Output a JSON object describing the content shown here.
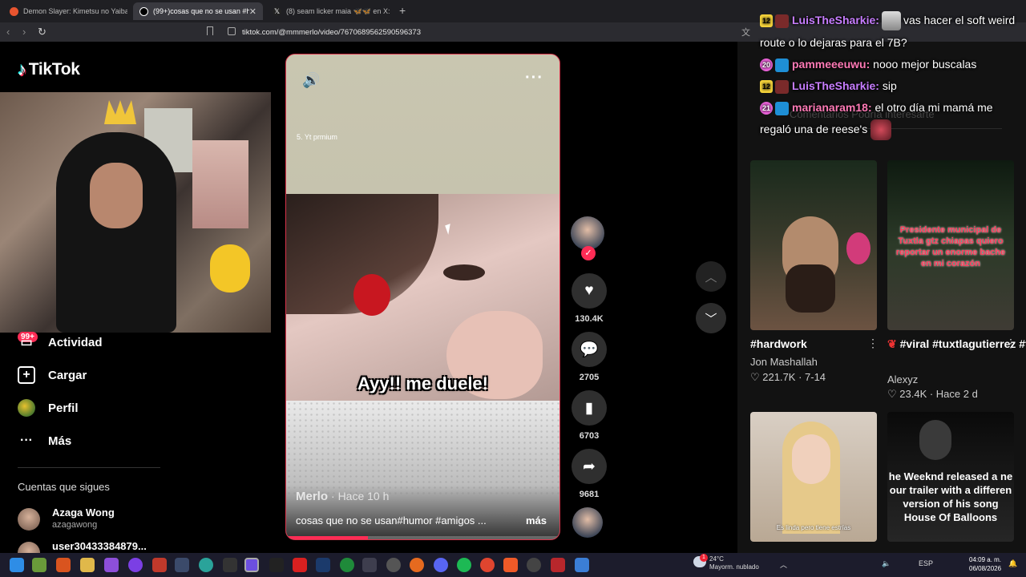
{
  "browser": {
    "tabs": [
      {
        "title": "Demon Slayer: Kimetsu no Yaiba en B",
        "color": "#e8542f"
      },
      {
        "title": "(99+)cosas que no se usan #hum",
        "color": "#ffffff"
      },
      {
        "title": "(8) seam licker maia 🦋🦋 en X: \"Du",
        "color": "#ffffff"
      }
    ],
    "url": "tiktok.com/@mmmerlo/video/7670689562590596373"
  },
  "sidebar": {
    "logo_text": "TikTok",
    "notif_badge": "99+",
    "nav": [
      {
        "label": "Actividad",
        "icon": "inbox-icon"
      },
      {
        "label": "Cargar",
        "icon": "upload-icon"
      },
      {
        "label": "Perfil",
        "icon": "profile-icon"
      },
      {
        "label": "Más",
        "icon": "more-icon"
      }
    ],
    "following_title": "Cuentas que sigues",
    "following": [
      {
        "name": "Azaga Wong",
        "handle": "azagawong"
      },
      {
        "name": "user30433384879...",
        "handle": ""
      }
    ]
  },
  "video": {
    "overlay_small_text": "5. Yt prmium",
    "caption": "Ayy!! me duele!",
    "author": "Merlo",
    "time": "· Hace 10 h",
    "description": "cosas que no se usan#humor #amigos ...",
    "more_label": "más",
    "progress": 0.3
  },
  "actions": {
    "likes": "130.4K",
    "comments": "2705",
    "saves": "6703",
    "shares": "9681"
  },
  "right_panel": {
    "tabs_text": "Comentarios     Podría interesarte",
    "chat": [
      {
        "level": "12",
        "level_style": "y",
        "user": "LuisTheSharkie",
        "text": "vas hacer el soft weird",
        "user_style": "u1"
      },
      {
        "level": "",
        "level_style": "",
        "user": "",
        "text": "route o lo dejaras para el 7B?",
        "user_style": ""
      },
      {
        "level": "20",
        "level_style": "p",
        "user": "pammeeeuwu",
        "text": "nooo mejor buscalas",
        "user_style": "u2"
      },
      {
        "level": "12",
        "level_style": "y",
        "user": "LuisTheSharkie",
        "text": "sip",
        "user_style": "u1"
      },
      {
        "level": "21",
        "level_style": "p",
        "user": "marianaram18",
        "text": "el otro día mi mamá me",
        "user_style": "u2"
      },
      {
        "level": "",
        "level_style": "",
        "user": "",
        "text": "regaló una de reese's",
        "user_style": ""
      }
    ],
    "cards": [
      {
        "title": "#hardwork",
        "user": "Jon Mashallah",
        "meta": "♡ 221.7K · 7-14",
        "thumb_text": ""
      },
      {
        "title": "#viral #tuxtlagutierrez #f...",
        "user": "Alexyz",
        "meta": "♡ 23.4K · Hace 2 d",
        "thumb_text": "Presidente municipal de Tuxtla gtz chiapas quiero reportar un enorme bache en mi corazón"
      },
      {
        "title": "",
        "user": "",
        "meta": "",
        "thumb_text": "Es linda pero tiene estrías"
      },
      {
        "title": "",
        "user": "",
        "meta": "",
        "thumb_text": "he Weeknd released a ne our trailer with a differen version of his song House Of Balloons"
      }
    ]
  },
  "taskbar": {
    "weather_temp": "24°C",
    "weather_desc": "Mayorm. nublado",
    "weather_badge": "1",
    "lang": "ESP",
    "time": "04:09 a. m.",
    "date": "06/08/2026"
  }
}
